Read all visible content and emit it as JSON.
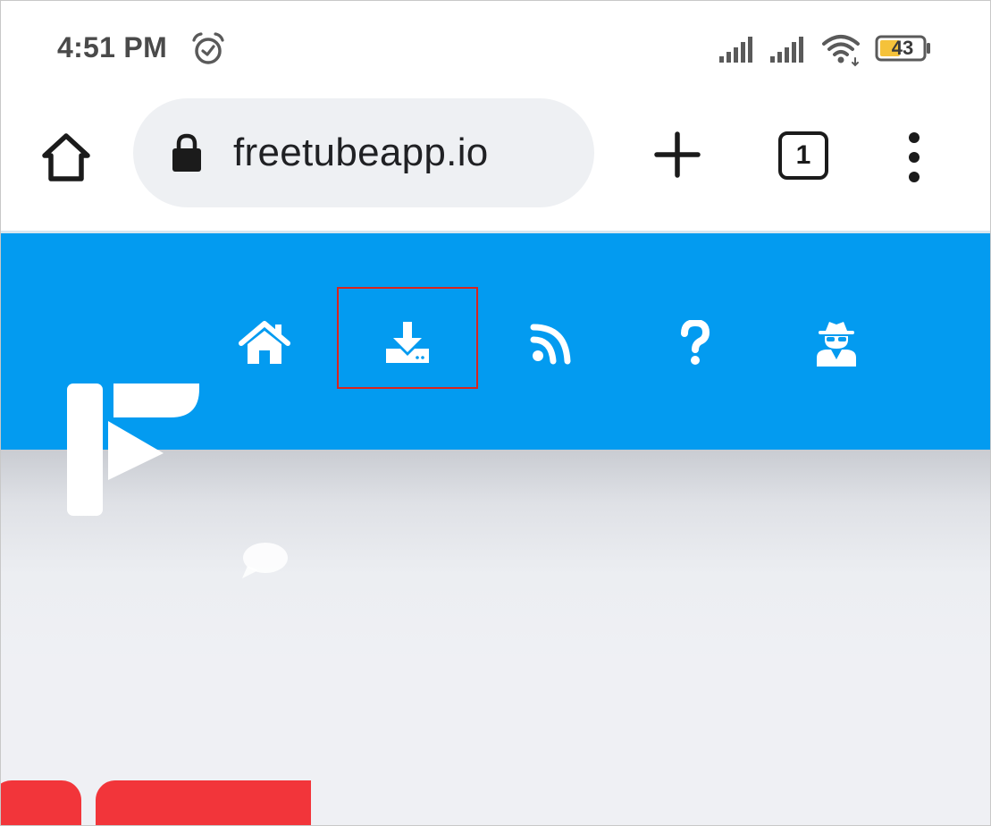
{
  "status_bar": {
    "time": "4:51 PM",
    "battery_level": "43",
    "icons": [
      "alarm-icon",
      "cellular-signal-icon",
      "cellular-signal-icon",
      "wifi-icon",
      "battery-icon"
    ]
  },
  "browser": {
    "url": "freetubeapp.io",
    "tab_count": "1",
    "icons": [
      "home-icon",
      "lock-icon",
      "plus-icon",
      "more-vert-icon"
    ]
  },
  "site": {
    "header_color": "#039bf0",
    "nav": [
      {
        "name": "home",
        "icon": "house-icon"
      },
      {
        "name": "download",
        "icon": "download-icon"
      },
      {
        "name": "blog",
        "icon": "rss-icon"
      },
      {
        "name": "help",
        "icon": "question-icon"
      },
      {
        "name": "privacy",
        "icon": "spy-icon"
      }
    ],
    "highlighted_nav": "download",
    "highlight_color": "#d9241e",
    "logo": "freetube-logo"
  }
}
